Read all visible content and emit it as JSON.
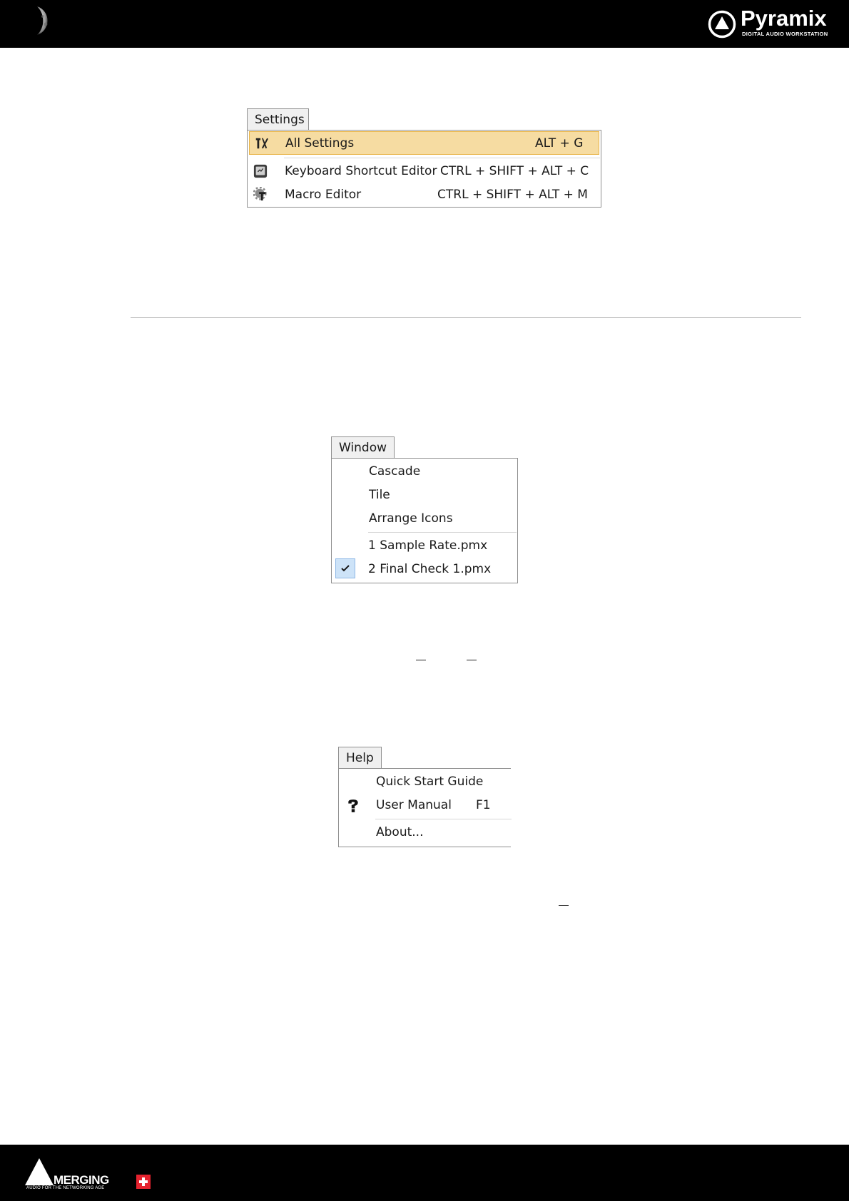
{
  "header": {
    "brand_name": "Pyramix",
    "brand_tagline": "DIGITAL AUDIO WORKSTATION"
  },
  "footer": {
    "brand_name": "MERGING",
    "slogan": "AUDIO FOR THE NETWORKING AGE"
  },
  "settings_menu": {
    "title": "Settings",
    "items": [
      {
        "icon": "tools-icon",
        "label": "All Settings",
        "shortcut": "ALT + G",
        "highlighted": true
      },
      {
        "icon": "keyboard-icon",
        "label": "Keyboard Shortcut Editor",
        "shortcut": "CTRL + SHIFT + ALT + C"
      },
      {
        "icon": "gear-macro-icon",
        "label": "Macro Editor",
        "shortcut": "CTRL + SHIFT + ALT + M"
      }
    ]
  },
  "window_menu": {
    "title": "Window",
    "items": [
      {
        "label": "Cascade"
      },
      {
        "label": "Tile"
      },
      {
        "label": "Arrange Icons"
      },
      {
        "label": "1 Sample Rate.pmx"
      },
      {
        "label": "2 Final Check 1.pmx",
        "checked": true,
        "icon": "checkmark-icon"
      }
    ]
  },
  "help_menu": {
    "title": "Help",
    "items": [
      {
        "label": "Quick Start Guide"
      },
      {
        "icon": "help-question-icon",
        "label": "User Manual",
        "shortcut": "F1"
      },
      {
        "label": "About..."
      }
    ]
  }
}
